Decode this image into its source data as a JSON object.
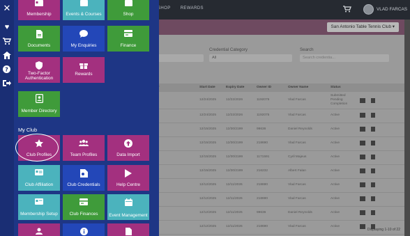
{
  "topbar": {
    "nav": [
      "SHOP",
      "REWARDS"
    ],
    "user_name": "VLAD FARCAS"
  },
  "club_select": "San Antonio Table Tennis Club",
  "filters": {
    "credential_category_label": "Credential Category",
    "credential_category_value": "All",
    "search_label": "Search",
    "search_placeholder": "Search credentia..."
  },
  "table": {
    "headers": [
      "ry",
      "Start Date",
      "Expiry Date",
      "Owner ID",
      "Owner Name",
      "Status"
    ],
    "rows": [
      {
        "start": "12/24/2025",
        "expiry": "12/22/2026",
        "owner_id": "1192075",
        "owner": "Vlad Farcas",
        "status": "Submitted Pending Completion"
      },
      {
        "start": "12/24/2025",
        "expiry": "12/22/2026",
        "owner_id": "1192075",
        "owner": "Vlad Farcas",
        "status": "Active"
      },
      {
        "start": "12/15/2025",
        "expiry": "12/30/2199",
        "owner_id": "99636",
        "owner": "Daniel Reynolds",
        "status": "Active"
      },
      {
        "start": "12/15/2025",
        "expiry": "12/30/2199",
        "owner_id": "218690",
        "owner": "Vlad Farcas",
        "status": "Active"
      },
      {
        "start": "12/15/2025",
        "expiry": "12/30/2199",
        "owner_id": "1171591",
        "owner": "Cyril Majeus",
        "status": "Active"
      },
      {
        "start": "12/15/2025",
        "expiry": "12/30/2199",
        "owner_id": "216232",
        "owner": "Albert Falan",
        "status": "Active"
      },
      {
        "start": "12/12/2025",
        "expiry": "12/11/2026",
        "owner_id": "218690",
        "owner": "Vlad Farcas",
        "status": "Active"
      },
      {
        "start": "12/12/2025",
        "expiry": "12/11/2026",
        "owner_id": "218690",
        "owner": "Vlad Farcas",
        "status": "Active"
      },
      {
        "start": "12/12/2025",
        "expiry": "12/11/2026",
        "owner_id": "99636",
        "owner": "Daniel Reynolds",
        "status": "Active"
      },
      {
        "start": "12/12/2025",
        "expiry": "12/11/2026",
        "owner_id": "218690",
        "owner": "Vlad Farcas",
        "status": "Active"
      }
    ],
    "footer": "Displaying 1-10 of 22"
  },
  "menu": {
    "top_row": [
      "Membership",
      "Events & Courses",
      "Shop"
    ],
    "row2": [
      "Documents",
      "My Enquiries",
      "Finance"
    ],
    "row3": [
      "Two-Factor Authentication",
      "Rewards"
    ],
    "member_directory": "Member Directory",
    "section_title": "My Club",
    "club_row1": [
      "Club Profiles",
      "Team Profiles",
      "Data Import"
    ],
    "club_row2": [
      "Club Affiliation",
      "Club Credentials",
      "Help Centre"
    ],
    "club_row3": [
      "Membership Setup",
      "Club Finances",
      "Event Management"
    ]
  },
  "colors": {
    "menu_bg": "#1e3685",
    "tile_purple": "#a3307f",
    "tile_blue": "#2347b8",
    "tile_green": "#3f9b3a",
    "tile_teal": "#4bb3bd"
  }
}
